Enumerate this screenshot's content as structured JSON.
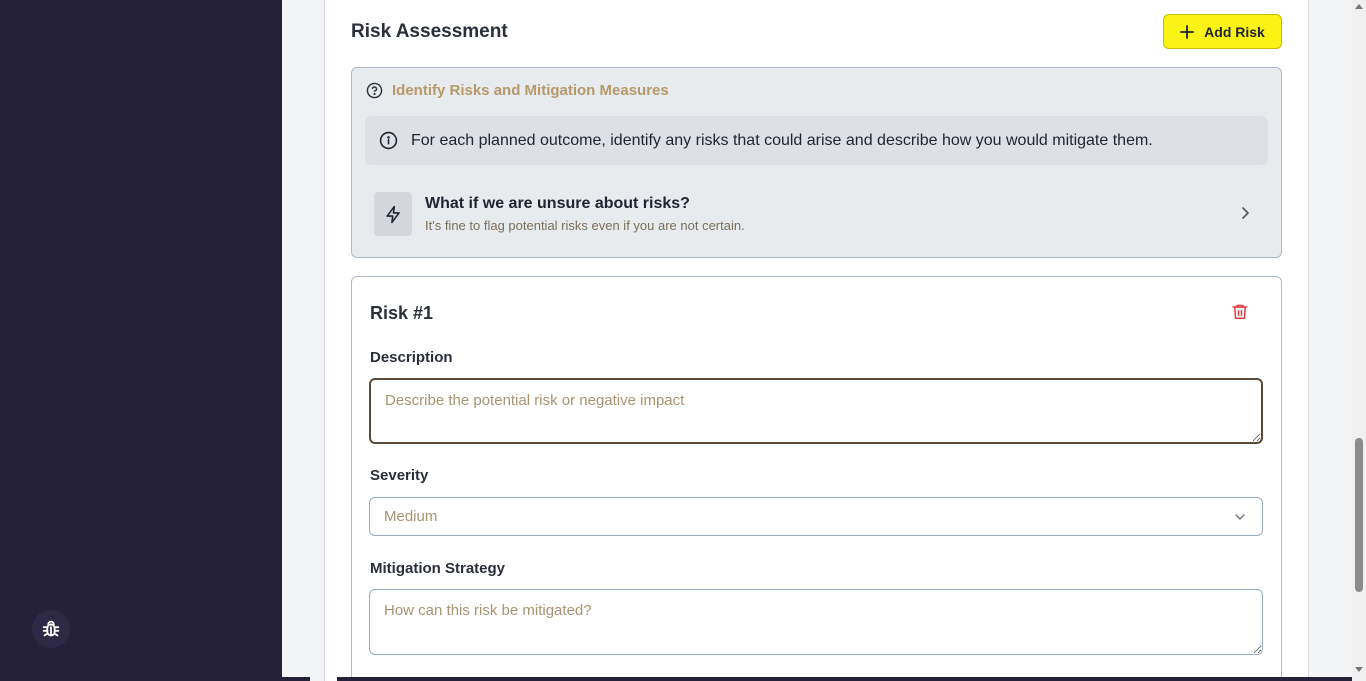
{
  "section": {
    "title": "Risk Assessment",
    "add_button": "Add Risk"
  },
  "guidance": {
    "title": "Identify Risks and Mitigation Measures",
    "note": "For each planned outcome, identify any risks that could arise and describe how you would mitigate them.",
    "faq_question": "What if we are unsure about risks?",
    "faq_answer": "It's fine to flag potential risks even if you are not certain."
  },
  "risk": {
    "title": "Risk #1",
    "description_label": "Description",
    "description_placeholder": "Describe the potential risk or negative impact",
    "description_value": "",
    "severity_label": "Severity",
    "severity_value": "Medium",
    "mitigation_label": "Mitigation Strategy",
    "mitigation_placeholder": "How can this risk be mitigated?",
    "mitigation_value": ""
  },
  "icons": {
    "add": "plus-icon",
    "help": "question-circle-icon",
    "info": "info-circle-icon",
    "faq": "lightning-icon",
    "expand": "chevron-right-icon",
    "delete": "trash-icon",
    "dropdown": "chevron-down-icon",
    "debug": "bug-icon"
  },
  "colors": {
    "sidebar": "#26213a",
    "accent_button": "#fbf314",
    "guidance_title": "#b5996a",
    "delete": "#e03a3a"
  }
}
